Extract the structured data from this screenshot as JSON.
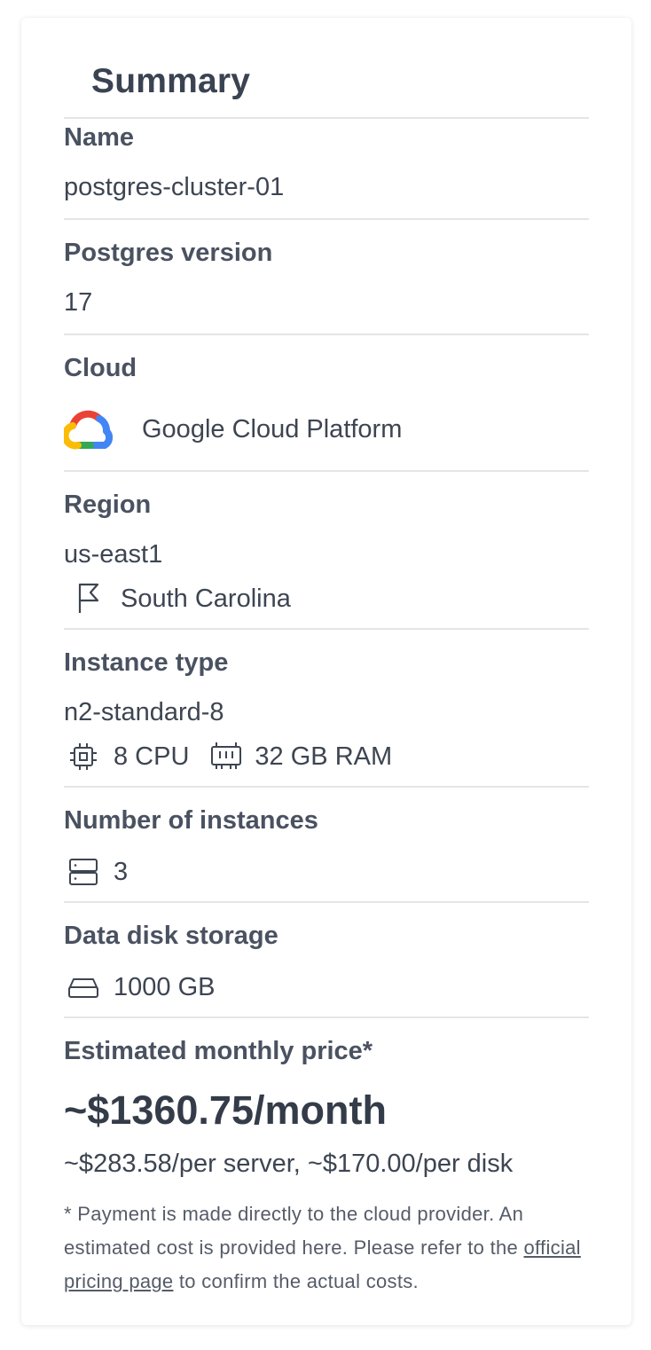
{
  "summary": {
    "title": "Summary",
    "name": {
      "label": "Name",
      "value": "postgres-cluster-01"
    },
    "version": {
      "label": "Postgres version",
      "value": "17"
    },
    "cloud": {
      "label": "Cloud",
      "value": "Google Cloud Platform",
      "icon": "google-cloud-logo"
    },
    "region": {
      "label": "Region",
      "value": "us-east1",
      "location": "South Carolina",
      "icon": "flag-icon"
    },
    "instance_type": {
      "label": "Instance type",
      "value": "n2-standard-8",
      "cpu": "8 CPU",
      "ram": "32 GB RAM",
      "cpu_icon": "cpu-icon",
      "ram_icon": "memory-icon"
    },
    "instances": {
      "label": "Number of instances",
      "value": "3",
      "icon": "server-icon"
    },
    "storage": {
      "label": "Data disk storage",
      "value": "1000 GB",
      "icon": "hard-drive-icon"
    },
    "price": {
      "label": "Estimated monthly price*",
      "total": "~$1360.75/month",
      "breakdown": "~$283.58/per server, ~$170.00/per disk",
      "note_start": "* Payment is made directly to the cloud provider. An estimated cost is provided here. Please refer to the ",
      "note_link": "official pricing page",
      "note_end": " to confirm the actual costs."
    }
  }
}
